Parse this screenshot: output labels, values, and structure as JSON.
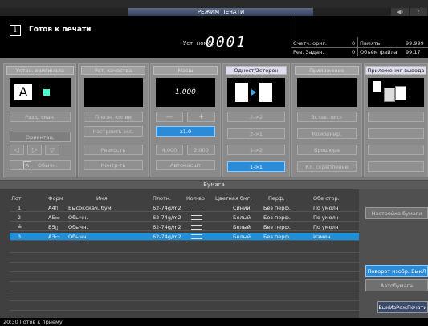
{
  "header": {
    "title": "РЕЖИМ ПЕЧАТИ",
    "btn1": "◀)",
    "btn2": "?"
  },
  "status": {
    "text": "Готов к печати",
    "set_label": "Уст. номер",
    "set_number": "0001"
  },
  "counters": {
    "orig_label": "Счетч. ориг.",
    "orig_val": "0",
    "res_label": "Рез. Задан.",
    "res_val": "0",
    "mem_label": "Память",
    "mem_val": "99.999",
    "file_label": "Объём файла",
    "file_val": "99.17"
  },
  "columns": {
    "original": {
      "head": "Устан. оригинала",
      "btn1": "Разд. скан.",
      "btn2": "Ориентац.",
      "btn3": "Обычн."
    },
    "quality": {
      "head": "Уст. качества",
      "btn1": "Плотн. копии",
      "btn2": "Настроить экс.",
      "btn3": "Резкость",
      "btn4": "Контр-ть"
    },
    "scale": {
      "head": "Масш",
      "value": "1.000",
      "minus": "—",
      "plus": "+",
      "x1": "x1.0",
      "v1": "4.000",
      "v2": "2.000",
      "auto": "Автомасшт"
    },
    "sides": {
      "head": "Одност/2сторон",
      "b1": "2->2",
      "b2": "2->1",
      "b3": "1->2",
      "b4": "1->1"
    },
    "app": {
      "head": "Приложение",
      "b1": "Встав. лист",
      "b2": "Комбинир.",
      "b3": "Брошюра",
      "b4": "Кл. скрепление"
    },
    "output": {
      "head": "Приложения вывода"
    }
  },
  "paper": {
    "bar": "Бумага",
    "headers": [
      "Лот.",
      "Форм",
      "Имя",
      "Плотн.",
      "Кол-во",
      "Цветная бмг.",
      "Перф.",
      "Обе стор."
    ],
    "rows": [
      {
        "tray": "1",
        "size": "A4▯",
        "name": "Высококач. бум.",
        "weight": "62-74g/m2",
        "color": "Синий",
        "punch": "Без перф.",
        "duplex": "По умолч"
      },
      {
        "tray": "2",
        "size": "A5▭",
        "name": "Обычн.",
        "weight": "62-74g/m2",
        "color": "Белый",
        "punch": "Без перф.",
        "duplex": "По умолч"
      },
      {
        "tray": "≟",
        "size": "B5▯",
        "name": "Обычн.",
        "weight": "62-74g/m2",
        "color": "Белый",
        "punch": "Без перф.",
        "duplex": "По умолч"
      },
      {
        "tray": "3",
        "size": "A3▭",
        "name": "Обычн.",
        "weight": "62-74g/m2",
        "color": "Белый",
        "punch": "Без перф.",
        "duplex": "Измен."
      }
    ]
  },
  "right": {
    "b1": "Настройка бумаги",
    "b2": "Поворот изобр. ВыкЛ",
    "b3": "Автобумага",
    "b4": "ВыкИзРежПечати"
  },
  "footer": {
    "text": "20:30  Готов к приему"
  }
}
